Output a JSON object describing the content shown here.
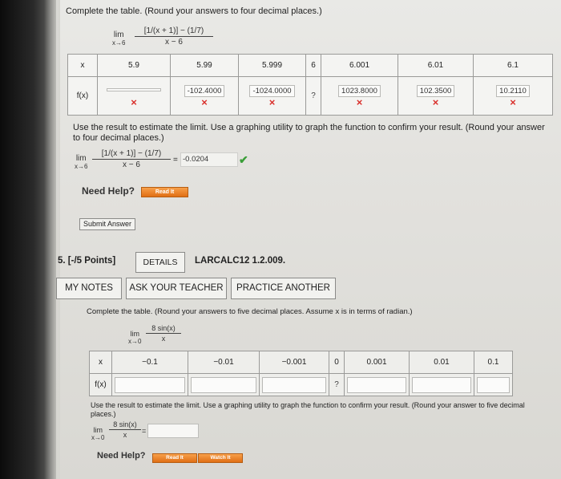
{
  "q4": {
    "instruction": "Complete the table. (Round your answers to four decimal places.)",
    "lim_word": "lim",
    "lim_sub": "x→6",
    "expr_num": "[1/(x + 1)] − (1/7)",
    "expr_den": "x − 6",
    "row_x_label": "x",
    "row_fx_label": "f(x)",
    "x_values": [
      "5.9",
      "5.99",
      "5.999",
      "6",
      "6.001",
      "6.01",
      "6.1"
    ],
    "fx_values": [
      "",
      "-102.4000",
      "-1024.0000",
      "?",
      "1023.8000",
      "102.3500",
      "10.2110"
    ],
    "wrong_mark": "×",
    "estimate_text": "Use the result to estimate the limit. Use a graphing utility to graph the function to confirm your result. (Round your answer to four decimal places.)",
    "equals": "=",
    "estimate_value": "-0.0204",
    "correct_mark": "✔",
    "need_help": "Need Help?",
    "read_it": "Read It",
    "submit": "Submit Answer"
  },
  "q5": {
    "header": "5. [-/5 Points]",
    "details": "DETAILS",
    "code": "LARCALC12 1.2.009.",
    "my_notes": "MY NOTES",
    "ask_teacher": "ASK YOUR TEACHER",
    "practice": "PRACTICE ANOTHER",
    "instruction": "Complete the table. (Round your answers to five decimal places. Assume x is in terms of radian.)",
    "lim_word": "lim",
    "lim_sub": "x→0",
    "expr_num": "8 sin(x)",
    "expr_den": "x",
    "row_x_label": "x",
    "row_fx_label": "f(x)",
    "x_values": [
      "−0.1",
      "−0.01",
      "−0.001",
      "0",
      "0.001",
      "0.01",
      "0.1"
    ],
    "fx_values": [
      "",
      "",
      "",
      "?",
      "",
      "",
      ""
    ],
    "estimate_text": "Use the result to estimate the limit. Use a graphing utility to graph the function to confirm your result. (Round your answer to five decimal places.)",
    "equals": "=",
    "need_help": "Need Help?",
    "read_it": "Read It",
    "watch_it": "Watch It"
  }
}
